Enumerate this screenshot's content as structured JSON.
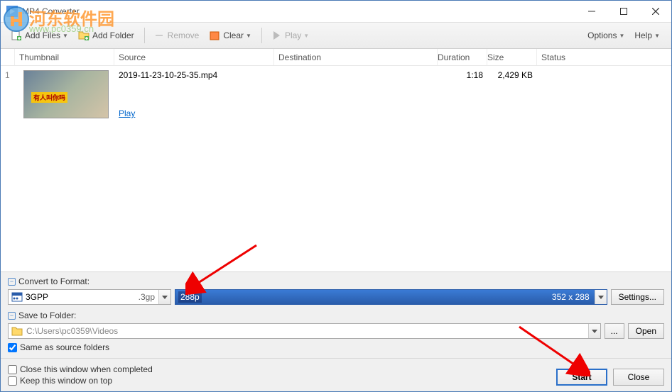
{
  "window": {
    "title": "MP4 Converter"
  },
  "watermark": {
    "text": "河东软件园",
    "url": "www.pc0359.cn"
  },
  "toolbar": {
    "add_files": "Add Files",
    "add_folder": "Add Folder",
    "remove": "Remove",
    "clear": "Clear",
    "play": "Play",
    "options": "Options",
    "help": "Help"
  },
  "table": {
    "headers": {
      "thumbnail": "Thumbnail",
      "source": "Source",
      "destination": "Destination",
      "duration": "Duration",
      "size": "Size",
      "status": "Status"
    },
    "rows": [
      {
        "index": "1",
        "source": "2019-11-23-10-25-35.mp4",
        "duration": "1:18",
        "size": "2,429 KB",
        "play_label": "Play",
        "thumb_overlay": "有人叫你吗"
      }
    ]
  },
  "convert": {
    "label": "Convert to Format:",
    "format_name": "3GPP",
    "format_ext": ".3gp",
    "resolution": "288p",
    "dimensions": "352 x 288",
    "settings_btn": "Settings..."
  },
  "save": {
    "label": "Save to Folder:",
    "path": "C:\\Users\\pc0359\\Videos",
    "browse_btn": "...",
    "open_btn": "Open",
    "same_as_source": "Same as source folders"
  },
  "footer": {
    "close_when_completed": "Close this window when completed",
    "keep_on_top": "Keep this window on top",
    "start_btn": "Start",
    "close_btn": "Close"
  }
}
